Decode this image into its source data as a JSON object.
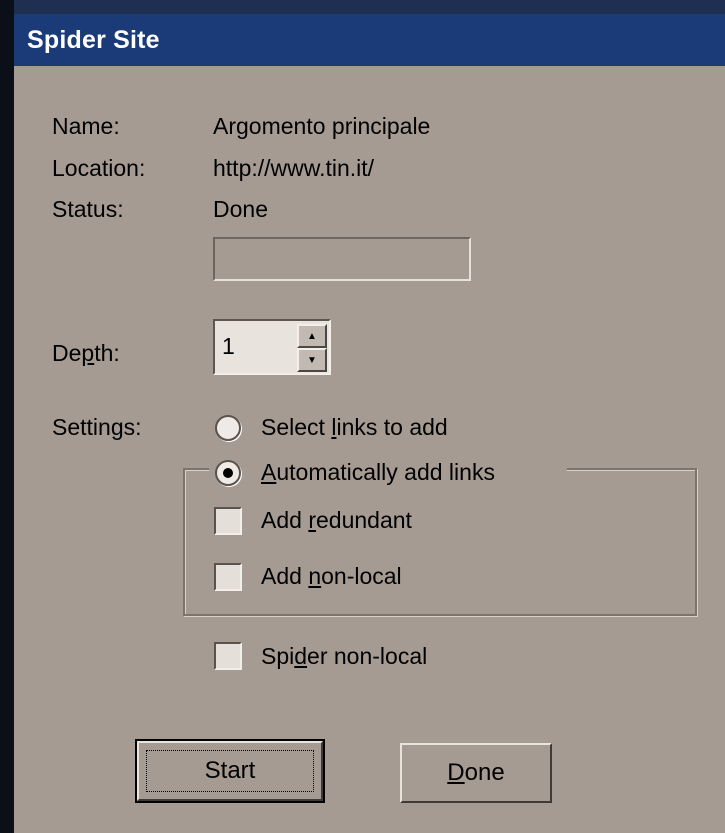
{
  "window": {
    "title": "Spider Site"
  },
  "info": {
    "name_label": "Name:",
    "name_value": "Argomento principale",
    "location_label": "Location:",
    "location_value": "http://www.tin.it/",
    "status_label": "Status:",
    "status_value": "Done"
  },
  "progress": {
    "value": 0
  },
  "depth": {
    "label_pre": "De",
    "label_ul": "p",
    "label_post": "th:",
    "value": "1"
  },
  "settings": {
    "label": "Settings:",
    "radio_select": {
      "pre": "Select ",
      "ul": "l",
      "post": "inks to add",
      "selected": false
    },
    "radio_auto": {
      "pre": "",
      "ul": "A",
      "post": "utomatically add links",
      "selected": true
    },
    "add_redundant": {
      "pre": "Add ",
      "ul": "r",
      "post": "edundant",
      "checked": false
    },
    "add_nonlocal": {
      "pre": "Add ",
      "ul": "n",
      "post": "on-local",
      "checked": false
    },
    "spider_nonlocal": {
      "pre": "Spi",
      "ul": "d",
      "post": "er non-local",
      "checked": false
    }
  },
  "buttons": {
    "start_label": "Start",
    "done_ul": "D",
    "done_post": "one"
  }
}
